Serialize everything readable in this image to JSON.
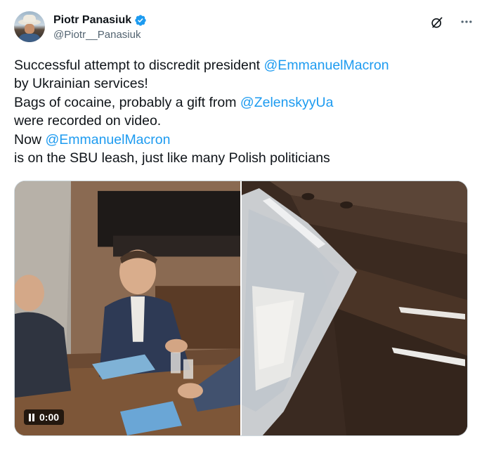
{
  "author": {
    "name": "Piotr Panasiuk",
    "handle": "@Piotr__Panasiuk",
    "verified": true,
    "verified_color": "#1d9bf0"
  },
  "tweet": {
    "lines": [
      {
        "text": "Successful attempt to discredit president ",
        "mention": "@EmmanuelMacron"
      },
      {
        "text": "by Ukrainian services!",
        "mention": ""
      },
      {
        "text": "Bags of cocaine, probably a gift from ",
        "mention": "@ZelenskyyUa"
      },
      {
        "text": "were recorded on video.",
        "mention": ""
      },
      {
        "text": "Now ",
        "mention": "@EmmanuelMacron"
      },
      {
        "text": "is on the SBU leash, just like many Polish politicians",
        "mention": ""
      }
    ],
    "mention_color": "#1d9bf0"
  },
  "media": {
    "video_time": "0:00",
    "video_state": "pause-icon"
  },
  "icons": {
    "grok": "grok-icon",
    "more": "more-icon"
  }
}
